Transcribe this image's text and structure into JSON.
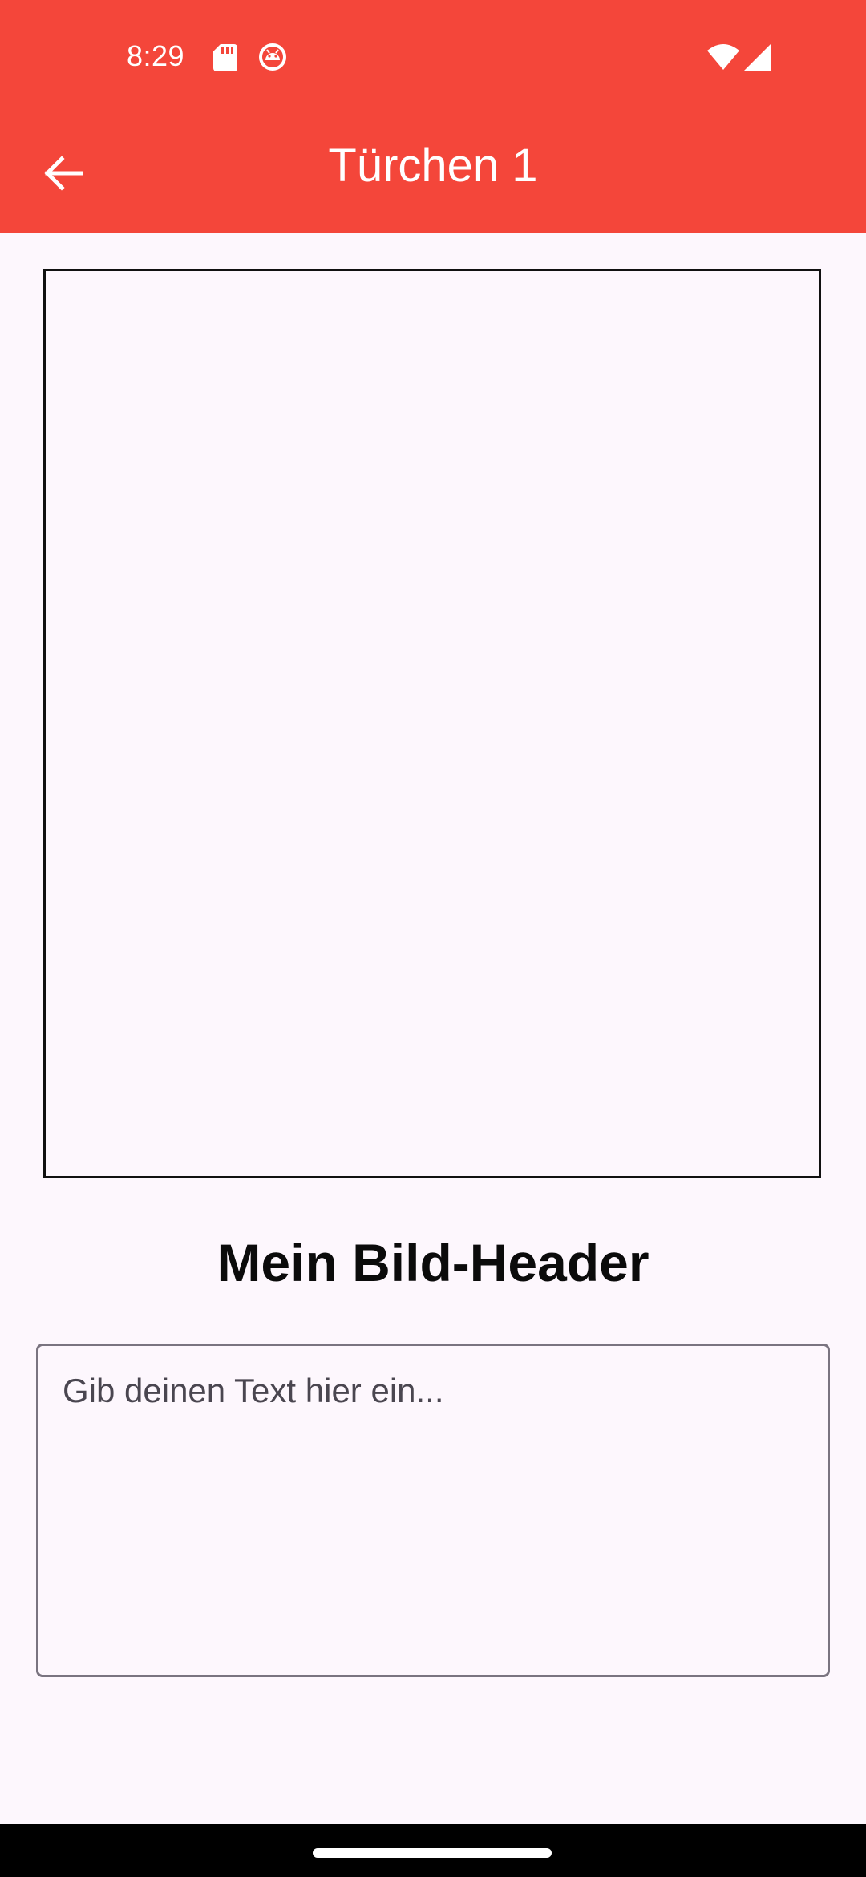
{
  "status_bar": {
    "time": "8:29",
    "icons": [
      "sd-card-icon",
      "android-debug-icon",
      "wifi-icon",
      "cell-signal-icon"
    ]
  },
  "app_bar": {
    "back_icon": "arrow-back-icon",
    "title": "Türchen 1"
  },
  "content": {
    "image_header": "Mein Bild-Header",
    "text_input": {
      "value": "",
      "placeholder": "Gib deinen Text hier ein..."
    }
  },
  "colors": {
    "app_bar": "#f4463a",
    "background": "#fdf7fd",
    "nav_bar": "#000000"
  }
}
